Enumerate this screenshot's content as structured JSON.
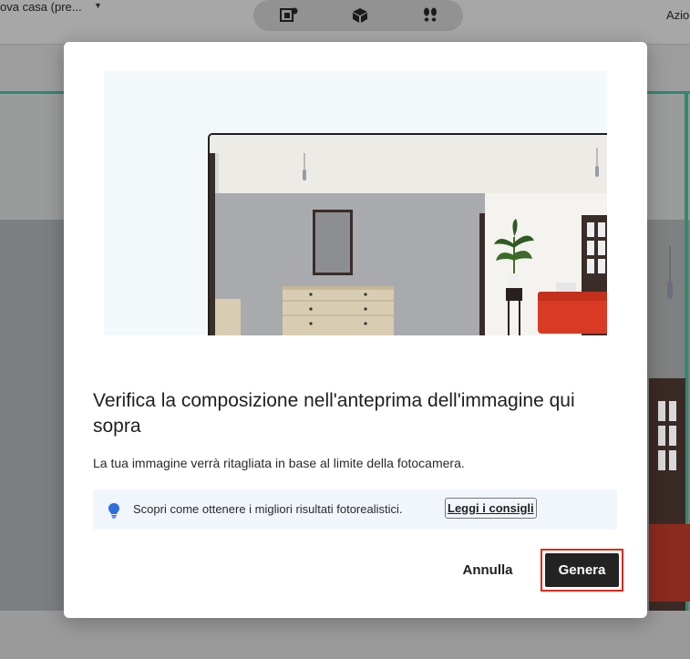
{
  "app": {
    "project_name": "ova casa (pre...",
    "actions_label": "Azio"
  },
  "toolbar": {
    "tools": [
      {
        "icon": "photo-render-icon"
      },
      {
        "icon": "3d-box-icon"
      },
      {
        "icon": "footprints-icon"
      }
    ]
  },
  "dialog": {
    "title": "Verifica la composizione nell'anteprima dell'immagine qui sopra",
    "subtitle": "La tua immagine verrà ritagliata in base al limite della fotocamera.",
    "tip_text": "Scopri come ottenere i migliori risultati fotorealistici.",
    "tip_link": "Leggi i consigli",
    "cancel_label": "Annulla",
    "generate_label": "Genera"
  },
  "colors": {
    "accent_highlight": "#e2280e",
    "primary_button": "#232323",
    "tip_bulb": "#2f6fe0",
    "stage_border": "#2e8a6e",
    "sofa": "#d93a24"
  }
}
